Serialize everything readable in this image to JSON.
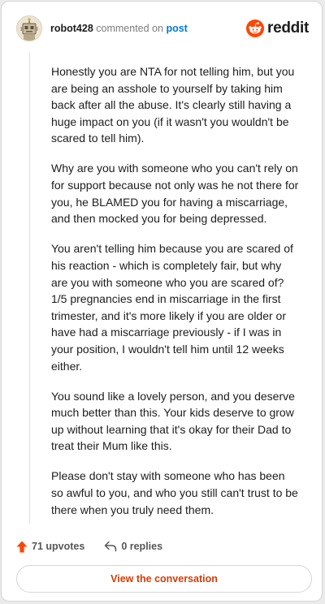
{
  "header": {
    "username": "robot428",
    "action_text": "commented on",
    "post_link": "post",
    "brand": "reddit"
  },
  "comment": {
    "paragraphs": [
      "Honestly you are NTA for not telling him, but you are being an asshole to yourself by taking him back after all the abuse. It's clearly still having a huge impact on you (if it wasn't you wouldn't be scared to tell him).",
      "Why are you with someone who you can't rely on for support because not only was he not there for you, he BLAMED you for having a miscarriage, and then mocked you for being depressed.",
      "You aren't telling him because you are scared of his reaction - which is completely fair, but why are you with someone who you are scared of? 1/5 pregnancies end in miscarriage in the first trimester, and it's more likely if you are older or have had a miscarriage previously - if I was in your position, I wouldn't tell him until 12 weeks either.",
      "You sound like a lovely person, and you deserve much better than this. Your kids deserve to grow up without learning that it's okay for their Dad to treat their Mum like this.",
      "Please don't stay with someone who has been so awful to you, and who you still can't trust to be there when you truly need them."
    ]
  },
  "footer": {
    "upvotes": "71 upvotes",
    "replies": "0 replies",
    "view_button": "View the conversation"
  },
  "colors": {
    "brand_orange": "#ff4500",
    "link_blue": "#0079d3",
    "button_text": "#d93a00"
  },
  "icons": {
    "avatar": "robot-avatar",
    "brand": "reddit-snoo-icon",
    "upvote": "upvote-arrow-icon",
    "reply": "reply-arrow-icon"
  }
}
